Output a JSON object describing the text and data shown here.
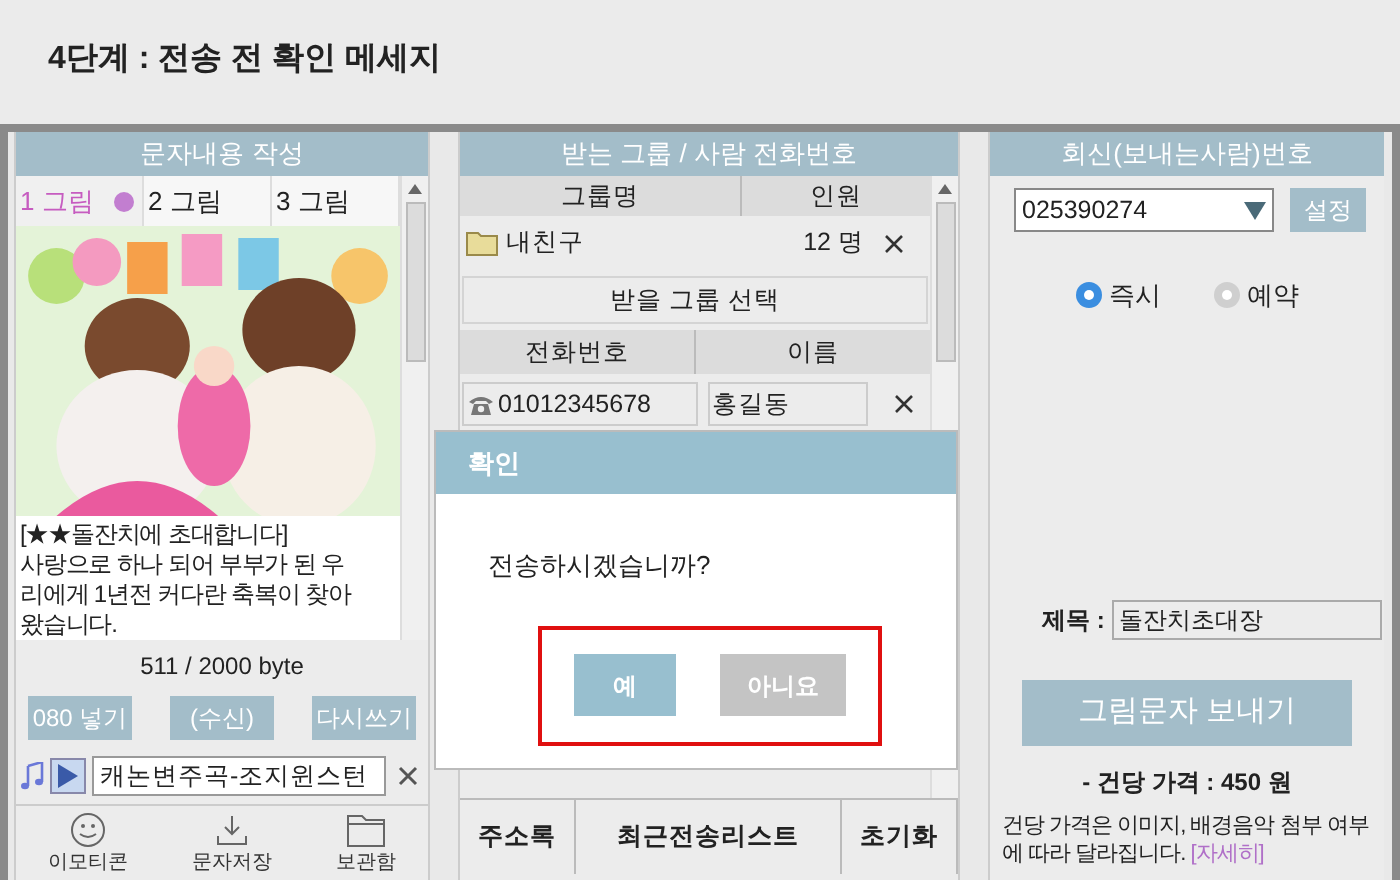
{
  "page_title": "4단계 : 전송 전 확인 메세지",
  "compose": {
    "title": "문자내용 작성",
    "tabs": [
      {
        "label": "1 그림",
        "selected": true
      },
      {
        "label": "2 그림",
        "selected": false
      },
      {
        "label": "3 그림",
        "selected": false
      }
    ],
    "message": "[★★돌잔치에 초대합니다]\n사랑으로 하나 되어 부부가 된 우\n리에게 1년전 커다란 축복이 찾아\n왔습니다.",
    "byte_count": "511 / 2000 byte",
    "buttons": [
      "080 넣기",
      "(수신)",
      "다시쓰기"
    ],
    "music": "캐논변주곡-조지윈스턴",
    "tools": [
      {
        "kind": "smile",
        "label": "이모티콘"
      },
      {
        "kind": "download",
        "label": "문자저장"
      },
      {
        "kind": "folder",
        "label": "보관함"
      }
    ]
  },
  "recipients": {
    "title": "받는 그룹 / 사람 전화번호",
    "group_columns": [
      "그룹명",
      "인원"
    ],
    "groups": [
      {
        "name": "내친구",
        "count": "12 명"
      }
    ],
    "select_group_button": "받을 그룹 선택",
    "person_columns": [
      "전화번호",
      "이름"
    ],
    "people": [
      {
        "phone": "01012345678",
        "name": "홍길동"
      }
    ],
    "bottom_buttons": [
      "주소록",
      "최근전송리스트",
      "초기화"
    ]
  },
  "sender": {
    "title": "회신(보내는사람)번호",
    "number": "025390274",
    "set_button": "설정",
    "timing": [
      {
        "label": "즉시",
        "selected": true
      },
      {
        "label": "예약",
        "selected": false
      }
    ],
    "subject_label": "제목 :",
    "subject": "돌잔치초대장",
    "send_button": "그림문자 보내기",
    "price": "- 건당 가격 : 450 원",
    "note": "건당 가격은 이미지, 배경음악 첨부 여부에 따라 달라집니다.",
    "more_link": "[자세히]"
  },
  "dialog": {
    "title": "확인",
    "message": "전송하시겠습니까?",
    "confirm": "예",
    "cancel": "아니요"
  }
}
